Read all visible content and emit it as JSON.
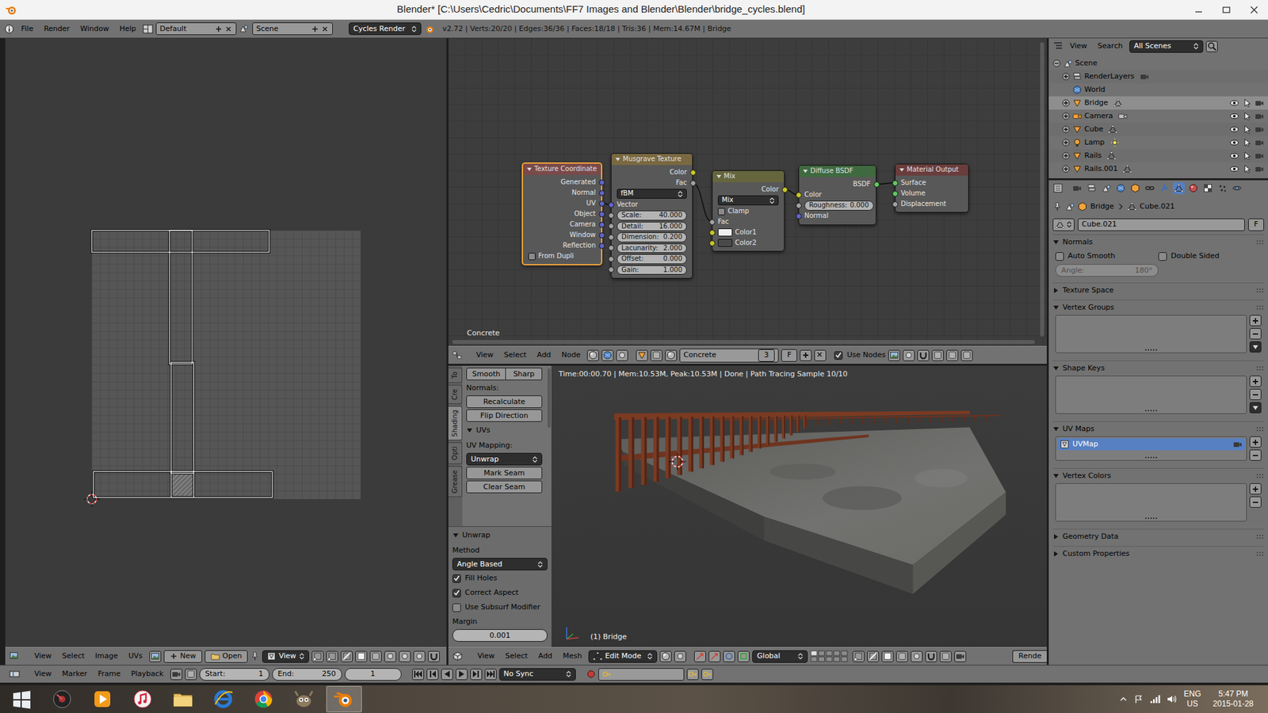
{
  "window": {
    "title": "Blender* [C:\\Users\\Cedric\\Documents\\FF7 Images and Blender\\Blender\\bridge_cycles.blend]"
  },
  "info_header": {
    "menus": [
      "File",
      "Render",
      "Window",
      "Help"
    ],
    "screen_layout": "Default",
    "scene": "Scene",
    "engine": "Cycles Render",
    "stats": "v2.72 | Verts:20/20 | Edges:36/36 | Faces:18/18 | Tris:36 | Mem:14.67M | Bridge"
  },
  "uv_editor": {
    "header": {
      "menus": [
        "View",
        "Select",
        "Image",
        "UVs"
      ],
      "new_button": "New",
      "open_button": "Open",
      "view": "View"
    }
  },
  "node_editor": {
    "material_label": "Concrete",
    "nodes": [
      {
        "title": "Texture Coordinate",
        "kind": "input",
        "selected": true,
        "rows": [
          {
            "kind": "output",
            "label": "Generated",
            "socket": "vector"
          },
          {
            "kind": "output",
            "label": "Normal",
            "socket": "vector"
          },
          {
            "kind": "output",
            "label": "UV",
            "socket": "vector"
          },
          {
            "kind": "output",
            "label": "Object",
            "socket": "vector"
          },
          {
            "kind": "output",
            "label": "Camera",
            "socket": "vector"
          },
          {
            "kind": "output",
            "label": "Window",
            "socket": "vector"
          },
          {
            "kind": "output",
            "label": "Reflection",
            "socket": "vector"
          },
          {
            "kind": "checkbox",
            "label": "From Dupli",
            "checked": false
          }
        ]
      },
      {
        "title": "Musgrave Texture",
        "kind": "texture",
        "selected": false,
        "rows": [
          {
            "kind": "output",
            "label": "Color",
            "socket": "color"
          },
          {
            "kind": "output",
            "label": "Fac",
            "socket": "float"
          },
          {
            "kind": "dropdown",
            "value": "fBM"
          },
          {
            "kind": "input",
            "label": "Vector",
            "socket": "vector"
          },
          {
            "kind": "field",
            "label": "Scale:",
            "value": "40.000",
            "socket": "float"
          },
          {
            "kind": "field",
            "label": "Detail:",
            "value": "16.000",
            "socket": "float"
          },
          {
            "kind": "field",
            "label": "Dimension:",
            "value": "0.200",
            "socket": "float"
          },
          {
            "kind": "field",
            "label": "Lacunarity:",
            "value": "2.000",
            "socket": "float"
          },
          {
            "kind": "field",
            "label": "Offset:",
            "value": "0.000",
            "socket": "float"
          },
          {
            "kind": "field",
            "label": "Gain:",
            "value": "1.000",
            "socket": "float"
          }
        ]
      },
      {
        "title": "Mix",
        "kind": "color",
        "selected": false,
        "rows": [
          {
            "kind": "output",
            "label": "Color",
            "socket": "color"
          },
          {
            "kind": "dropdown",
            "value": "Mix"
          },
          {
            "kind": "checkbox",
            "label": "Clamp",
            "checked": false
          },
          {
            "kind": "input",
            "label": "Fac",
            "socket": "float"
          },
          {
            "kind": "swatch",
            "label": "Color1",
            "color": "#f0f0f0",
            "socket": "color"
          },
          {
            "kind": "swatch",
            "label": "Color2",
            "color": "#4a4a4a",
            "socket": "color"
          }
        ]
      },
      {
        "title": "Diffuse BSDF",
        "kind": "shader",
        "selected": false,
        "rows": [
          {
            "kind": "output",
            "label": "BSDF",
            "socket": "shader"
          },
          {
            "kind": "input",
            "label": "Color",
            "socket": "color"
          },
          {
            "kind": "field",
            "label": "Roughness:",
            "value": "0.000",
            "socket": "float"
          },
          {
            "kind": "input",
            "label": "Normal",
            "socket": "vector"
          }
        ]
      },
      {
        "title": "Material Output",
        "kind": "output",
        "selected": false,
        "rows": [
          {
            "kind": "input",
            "label": "Surface",
            "socket": "shader"
          },
          {
            "kind": "input",
            "label": "Volume",
            "socket": "shader"
          },
          {
            "kind": "input",
            "label": "Displacement",
            "socket": "float"
          }
        ]
      }
    ],
    "links": [
      {
        "from": {
          "node": 0,
          "row": 2
        },
        "to": {
          "node": 1,
          "row": 3
        }
      },
      {
        "from": {
          "node": 1,
          "row": 1
        },
        "to": {
          "node": 2,
          "row": 3
        }
      },
      {
        "from": {
          "node": 2,
          "row": 0
        },
        "to": {
          "node": 3,
          "row": 1
        }
      },
      {
        "from": {
          "node": 3,
          "row": 0
        },
        "to": {
          "node": 4,
          "row": 0
        }
      }
    ],
    "header": {
      "menus": [
        "View",
        "Select",
        "Add",
        "Node"
      ],
      "material": "Concrete",
      "users": "3",
      "fake_user": "F",
      "use_nodes": {
        "label": "Use Nodes",
        "checked": true
      }
    }
  },
  "tool_shelf": {
    "tabs": [
      {
        "label": "To",
        "selected": false
      },
      {
        "label": "Cre",
        "selected": false
      },
      {
        "label": "Shading",
        "selected": true
      },
      {
        "label": "Opti",
        "selected": false
      },
      {
        "label": "Grease",
        "selected": false
      }
    ],
    "smooth": "Smooth",
    "sharp": "Sharp",
    "normals_label": "Normals:",
    "recalculate": "Recalculate",
    "flip": "Flip Direction",
    "uvs_panel": {
      "title": "UVs",
      "expanded": true
    },
    "uv_mapping_label": "UV Mapping:",
    "unwrap_dropdown": "Unwrap",
    "mark_seam": "Mark Seam",
    "clear_seam": "Clear Seam"
  },
  "operator_panel": {
    "title": "Unwrap",
    "expanded": true,
    "method_label": "Method",
    "method": "Angle Based",
    "options": [
      {
        "label": "Fill Holes",
        "checked": true
      },
      {
        "label": "Correct Aspect",
        "checked": true
      },
      {
        "label": "Use Subsurf Modifier",
        "checked": false
      }
    ],
    "margin_label": "Margin",
    "margin": "0.001"
  },
  "viewport": {
    "render_info": "Time:00:00.70 | Mem:10.53M, Peak:10.53M | Done | Path Tracing Sample 10/10",
    "object_info": "(1) Bridge",
    "header": {
      "menus": [
        "View",
        "Select",
        "Add",
        "Mesh"
      ],
      "mode": "Edit Mode",
      "orientation": "Global",
      "render_button": "Rende"
    }
  },
  "outliner": {
    "header": {
      "menus": [
        "View",
        "Search"
      ],
      "filter": "All Scenes"
    },
    "items": [
      {
        "label": "Scene",
        "kind": "scene",
        "expandable": true,
        "expanded": true,
        "selected": false
      },
      {
        "label": "RenderLayers",
        "kind": "renderlayers",
        "expandable": true,
        "expanded": false,
        "selected": false
      },
      {
        "label": "World",
        "kind": "world",
        "expandable": false,
        "expanded": false,
        "selected": false
      },
      {
        "label": "Bridge",
        "kind": "mesh",
        "expandable": true,
        "expanded": false,
        "selected": true,
        "visible": true
      },
      {
        "label": "Camera",
        "kind": "camera",
        "expandable": true,
        "expanded": false,
        "selected": false,
        "visible": true
      },
      {
        "label": "Cube",
        "kind": "mesh",
        "expandable": true,
        "expanded": false,
        "selected": false,
        "visible": true
      },
      {
        "label": "Lamp",
        "kind": "lamp",
        "expandable": true,
        "expanded": false,
        "selected": false,
        "visible": true
      },
      {
        "label": "Rails",
        "kind": "mesh",
        "expandable": true,
        "expanded": false,
        "selected": false,
        "visible": true
      },
      {
        "label": "Rails.001",
        "kind": "mesh",
        "expandable": true,
        "expanded": false,
        "selected": false,
        "visible": true
      }
    ]
  },
  "properties": {
    "tabs": [
      {
        "kind": "render",
        "selected": false
      },
      {
        "kind": "render_layers",
        "selected": false
      },
      {
        "kind": "scene",
        "selected": false
      },
      {
        "kind": "world",
        "selected": false
      },
      {
        "kind": "object",
        "selected": false
      },
      {
        "kind": "constraints",
        "selected": false
      },
      {
        "kind": "modifiers",
        "selected": false
      },
      {
        "kind": "data",
        "selected": true
      },
      {
        "kind": "material",
        "selected": false
      },
      {
        "kind": "texture",
        "selected": false
      },
      {
        "kind": "particles",
        "selected": false
      },
      {
        "kind": "physics",
        "selected": false
      }
    ],
    "breadcrumb": [
      "Bridge",
      "Cube.021"
    ],
    "mesh_name": "Cube.021",
    "fake_user": "F",
    "normals": {
      "auto_smooth": {
        "label": "Auto Smooth",
        "checked": false
      },
      "double_sided": {
        "label": "Double Sided",
        "checked": false
      },
      "angle": {
        "label": "Angle:",
        "value": "180°",
        "disabled": true
      }
    },
    "panels": [
      {
        "title": "Normals",
        "expanded": true,
        "kind": "normals"
      },
      {
        "title": "Texture Space",
        "expanded": false,
        "kind": "plain"
      },
      {
        "title": "Vertex Groups",
        "expanded": true,
        "kind": "list",
        "has_menu": true,
        "items": []
      },
      {
        "title": "Shape Keys",
        "expanded": true,
        "kind": "list",
        "has_menu": true,
        "items": []
      },
      {
        "title": "UV Maps",
        "expanded": true,
        "kind": "list",
        "has_menu": false,
        "items": [
          {
            "label": "UVMap",
            "selected": true
          }
        ]
      },
      {
        "title": "Vertex Colors",
        "expanded": true,
        "kind": "list",
        "has_menu": false,
        "items": []
      },
      {
        "title": "Geometry Data",
        "expanded": false,
        "kind": "plain"
      },
      {
        "title": "Custom Properties",
        "expanded": false,
        "kind": "plain"
      }
    ]
  },
  "timeline": {
    "menus": [
      "View",
      "Marker",
      "Frame",
      "Playback"
    ],
    "start": {
      "label": "Start:",
      "value": "1"
    },
    "end": {
      "label": "End:",
      "value": "250"
    },
    "current_frame": "1",
    "sync": "No Sync"
  },
  "taskbar": {
    "apps": [
      {
        "kind": "start",
        "selected": false
      },
      {
        "kind": "disc",
        "selected": false
      },
      {
        "kind": "media",
        "selected": false
      },
      {
        "kind": "itunes",
        "selected": false
      },
      {
        "kind": "explorer",
        "selected": false
      },
      {
        "kind": "ie",
        "selected": false
      },
      {
        "kind": "chrome",
        "selected": false
      },
      {
        "kind": "gimp",
        "selected": false
      },
      {
        "kind": "blender",
        "selected": true
      }
    ],
    "language": "ENG",
    "region": "US",
    "time": "5:47 PM",
    "date": "2015-01-28"
  }
}
